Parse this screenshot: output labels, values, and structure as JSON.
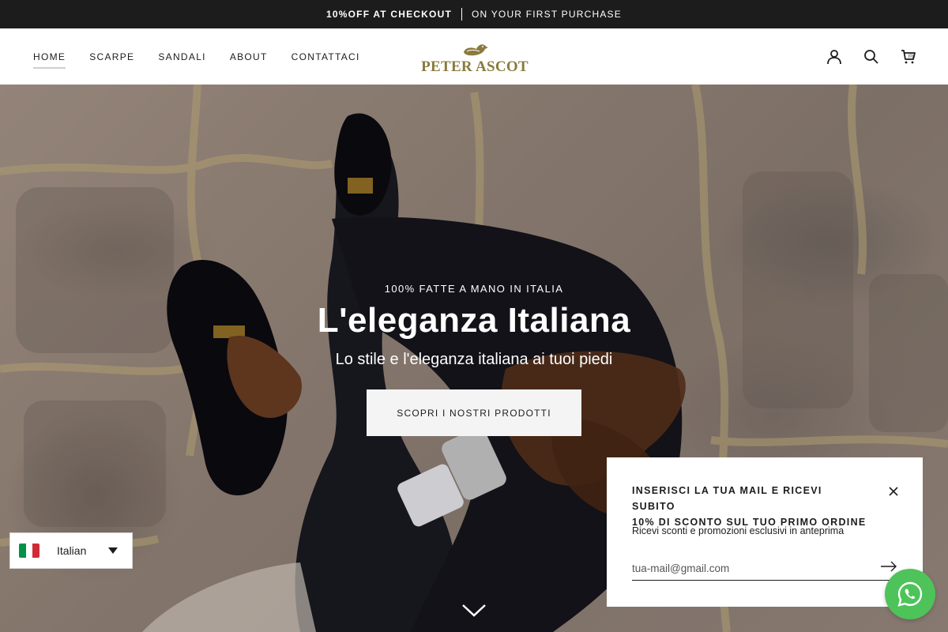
{
  "announcement": {
    "part1": "10%OFF AT CHECKOUT",
    "part2": "ON YOUR FIRST PURCHASE"
  },
  "nav": {
    "items": [
      {
        "label": "HOME",
        "active": true
      },
      {
        "label": "SCARPE"
      },
      {
        "label": "SANDALI"
      },
      {
        "label": "ABOUT"
      },
      {
        "label": "CONTATTACI"
      }
    ]
  },
  "logo": {
    "text": "PETER ASCOT"
  },
  "header_icons": [
    "account-icon",
    "search-icon",
    "cart-icon"
  ],
  "cart": {
    "count_label": "(0)"
  },
  "hero": {
    "eyebrow": "100% FATTE A MANO IN ITALIA",
    "title": "L'eleganza Italiana",
    "subtitle": "Lo stile e l'eleganza italiana ai tuoi piedi",
    "cta": "SCOPRI I NOSTRI PRODOTTI"
  },
  "language": {
    "label": "Italian"
  },
  "popup": {
    "title_line1": "INSERISCI LA TUA MAIL E RICEVI SUBITO",
    "title_line2": "10% DI SCONTO SUL TUO PRIMO ORDINE",
    "text": "Ricevi sconti e promozioni esclusivi in anteprima",
    "email_placeholder": "tua-mail@gmail.com"
  },
  "colors": {
    "announcement_bg": "#1c1c1c",
    "logo_gold": "#8a7a3d",
    "whatsapp_green": "#4dc35a"
  }
}
